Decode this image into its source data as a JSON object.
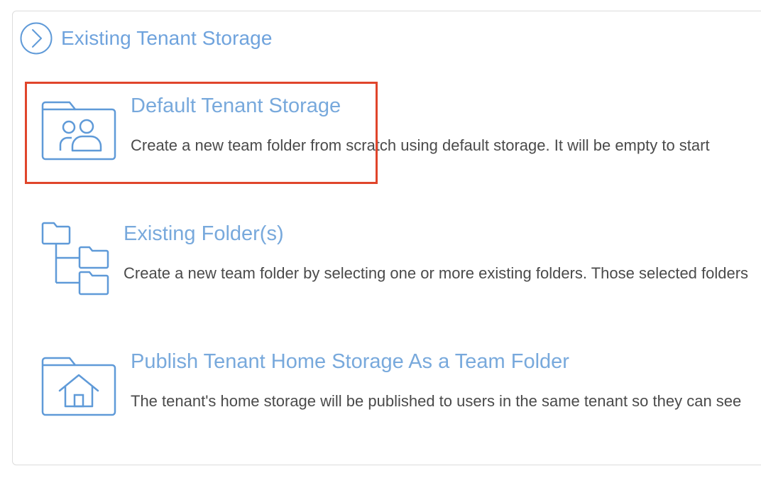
{
  "header": {
    "title": "Existing Tenant Storage",
    "icon": "chevron-right-circle-icon"
  },
  "options": [
    {
      "title": "Default Tenant Storage",
      "description": "Create a new team folder from scratch using default storage. It will be empty to start",
      "icon": "folder-users-icon",
      "selected": true
    },
    {
      "title": "Existing Folder(s)",
      "description": "Create a new team folder by selecting one or more existing folders. Those selected folders",
      "icon": "folder-tree-icon",
      "selected": false
    },
    {
      "title": "Publish Tenant Home Storage As a Team Folder",
      "description": "The tenant's home storage will be published to users in the same tenant so they can see",
      "icon": "folder-home-icon",
      "selected": false
    }
  ],
  "colors": {
    "accent": "#6fa3dd",
    "icon_stroke": "#5f9ad8",
    "highlight": "#e0452b",
    "text": "#4a4a4a"
  }
}
